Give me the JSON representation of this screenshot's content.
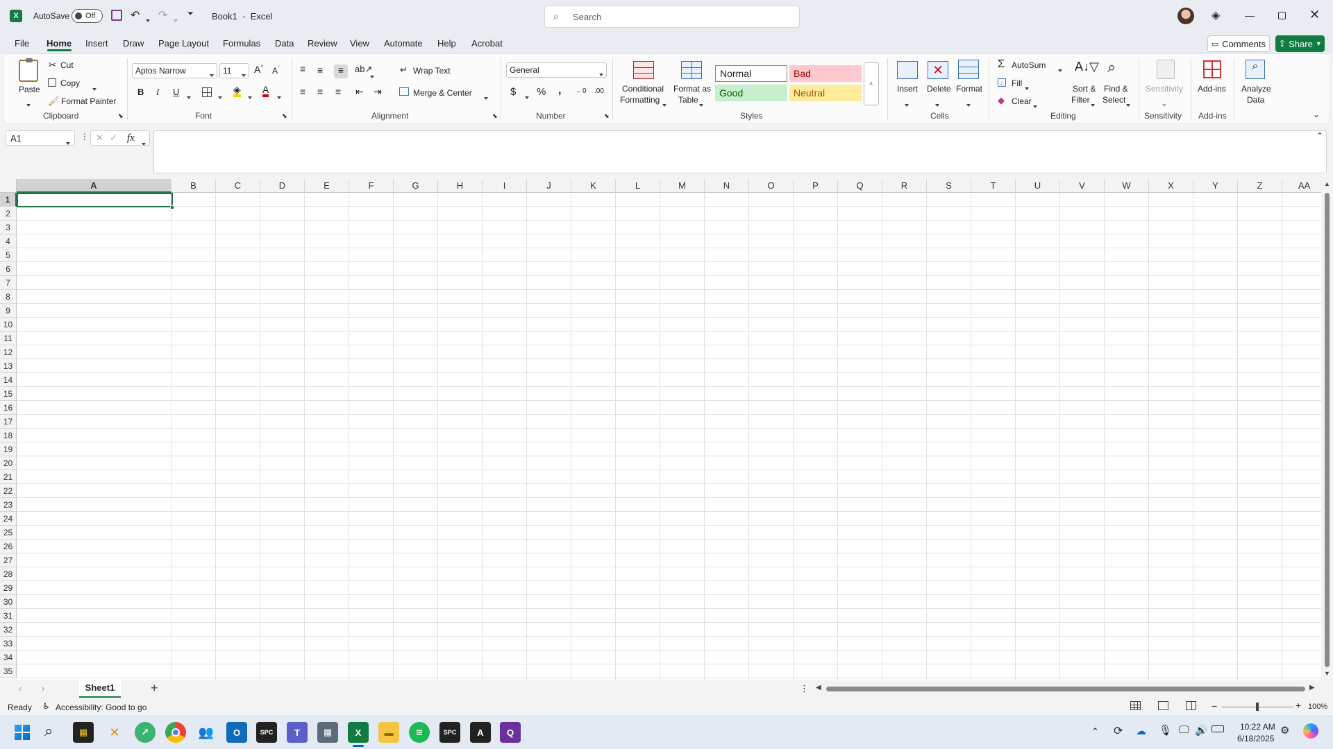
{
  "titlebar": {
    "autosave_label": "AutoSave",
    "autosave_state": "Off",
    "doc_title": "Book1  -  Excel",
    "search_placeholder": "Search"
  },
  "tabs": [
    "File",
    "Home",
    "Insert",
    "Draw",
    "Page Layout",
    "Formulas",
    "Data",
    "Review",
    "View",
    "Automate",
    "Help",
    "Acrobat"
  ],
  "actions": {
    "comments": "Comments",
    "share": "Share"
  },
  "clipboard": {
    "paste": "Paste",
    "cut": "Cut",
    "copy": "Copy",
    "format_painter": "Format Painter",
    "label": "Clipboard"
  },
  "font": {
    "name": "Aptos Narrow",
    "size": "11",
    "bold": "B",
    "italic": "I",
    "underline": "U",
    "label": "Font"
  },
  "alignment": {
    "wrap": "Wrap Text",
    "merge": "Merge & Center",
    "label": "Alignment"
  },
  "number": {
    "format": "General",
    "label": "Number"
  },
  "styles": {
    "conditional1": "Conditional",
    "conditional2": "Formatting",
    "fmt_table1": "Format as",
    "fmt_table2": "Table",
    "normal": "Normal",
    "bad": "Bad",
    "good": "Good",
    "neutral": "Neutral",
    "label": "Styles"
  },
  "cells": {
    "insert": "Insert",
    "delete": "Delete",
    "format": "Format",
    "label": "Cells"
  },
  "editing": {
    "autosum": "AutoSum",
    "fill": "Fill",
    "clear": "Clear",
    "sort1": "Sort &",
    "sort2": "Filter",
    "find1": "Find &",
    "find2": "Select",
    "label": "Editing"
  },
  "sensitivity": {
    "btn": "Sensitivity",
    "label": "Sensitivity"
  },
  "addins": {
    "btn": "Add-ins",
    "label": "Add-ins",
    "analyze1": "Analyze",
    "analyze2": "Data"
  },
  "formula_bar": {
    "namebox": "A1",
    "fx": "fx",
    "value": ""
  },
  "columns": [
    "A",
    "B",
    "C",
    "D",
    "E",
    "F",
    "G",
    "H",
    "I",
    "J",
    "K",
    "L",
    "M",
    "N",
    "O",
    "P",
    "Q",
    "R",
    "S",
    "T",
    "U",
    "V",
    "W",
    "X",
    "Y",
    "Z",
    "AA"
  ],
  "rows": [
    "1",
    "2",
    "3",
    "4",
    "5",
    "6",
    "7",
    "8",
    "9",
    "10",
    "11",
    "12",
    "13",
    "14",
    "15",
    "16",
    "17",
    "18",
    "19",
    "20",
    "21",
    "22",
    "23",
    "24",
    "25",
    "26",
    "27",
    "28",
    "29",
    "30",
    "31",
    "32",
    "33",
    "34",
    "35"
  ],
  "sheets": [
    "Sheet1"
  ],
  "status": {
    "ready": "Ready",
    "accessibility": "Accessibility: Good to go",
    "zoom": "100%"
  },
  "clock": {
    "time": "10:22 AM",
    "date": "6/18/2025"
  },
  "colors": {
    "excel_green": "#107c41",
    "selection": "#217346"
  }
}
